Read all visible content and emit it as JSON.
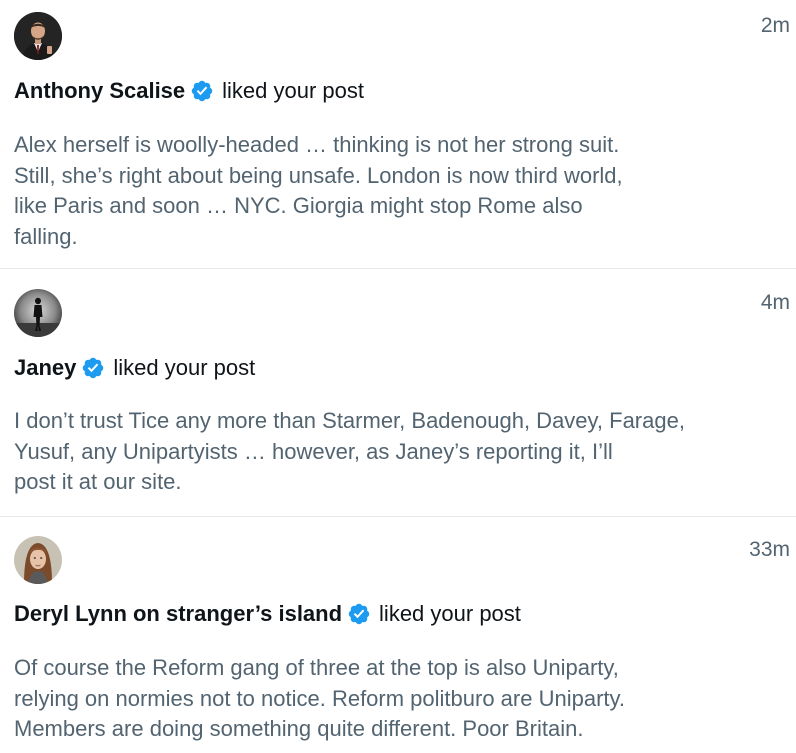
{
  "notifications": [
    {
      "user_name": "Anthony Scalise",
      "verified": true,
      "action": "liked your post",
      "time": "2m",
      "avatar_icon": "avatar-man-suit",
      "post_text": "Alex herself is woolly-headed … thinking is not her strong suit.\nStill, she’s right about being unsafe. London is now third world,\nlike Paris and soon … NYC.  Giorgia might stop Rome also\nfalling."
    },
    {
      "user_name": "Janey",
      "verified": true,
      "action": "liked your post",
      "time": "4m",
      "avatar_icon": "avatar-silhouette-figure",
      "post_text": "I don’t trust Tice any more than Starmer, Badenough, Davey, Farage,\nYusuf, any Unipartyists … however, as Janey’s reporting it, I’ll\npost it at our site."
    },
    {
      "user_name": "Deryl Lynn on stranger’s island",
      "verified": true,
      "action": "liked your post",
      "time": "33m",
      "avatar_icon": "avatar-woman-portrait",
      "post_text": "Of course the Reform gang of three at the top is also Uniparty,\nrelying on normies not to notice.  Reform politburo are Uniparty.\nMembers are doing something quite different. Poor Britain."
    }
  ],
  "colors": {
    "primary_text": "#0f1419",
    "secondary_text": "#536471",
    "verified_blue": "#1d9bf0",
    "divider": "#e7e9ea"
  }
}
